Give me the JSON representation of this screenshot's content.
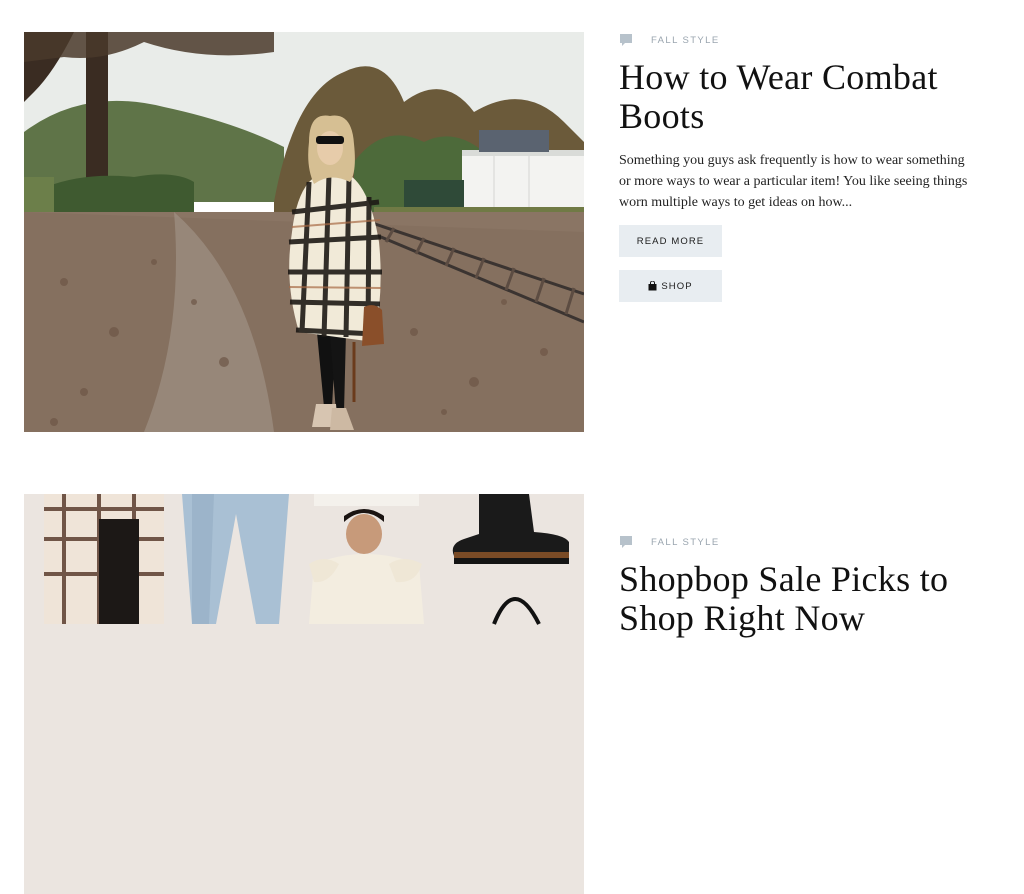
{
  "posts": [
    {
      "category": "FALL STYLE",
      "title": "How to Wear Combat Boots",
      "excerpt": "Something you guys ask frequently is how to wear something or more ways to wear a particular item! You like seeing things worn multiple ways to get ideas on how...",
      "read_more_label": "READ MORE",
      "shop_label": "SHOP",
      "image_icon": "photo-woman-railroad-tracks"
    },
    {
      "category": "FALL STYLE",
      "title": "Shopbop Sale Picks to Shop Right Now",
      "image_icon": "collage-fashion-products"
    }
  ],
  "colors": {
    "category_text": "#9aa5af",
    "button_bg": "#e8edf1",
    "title_text": "#111111"
  }
}
